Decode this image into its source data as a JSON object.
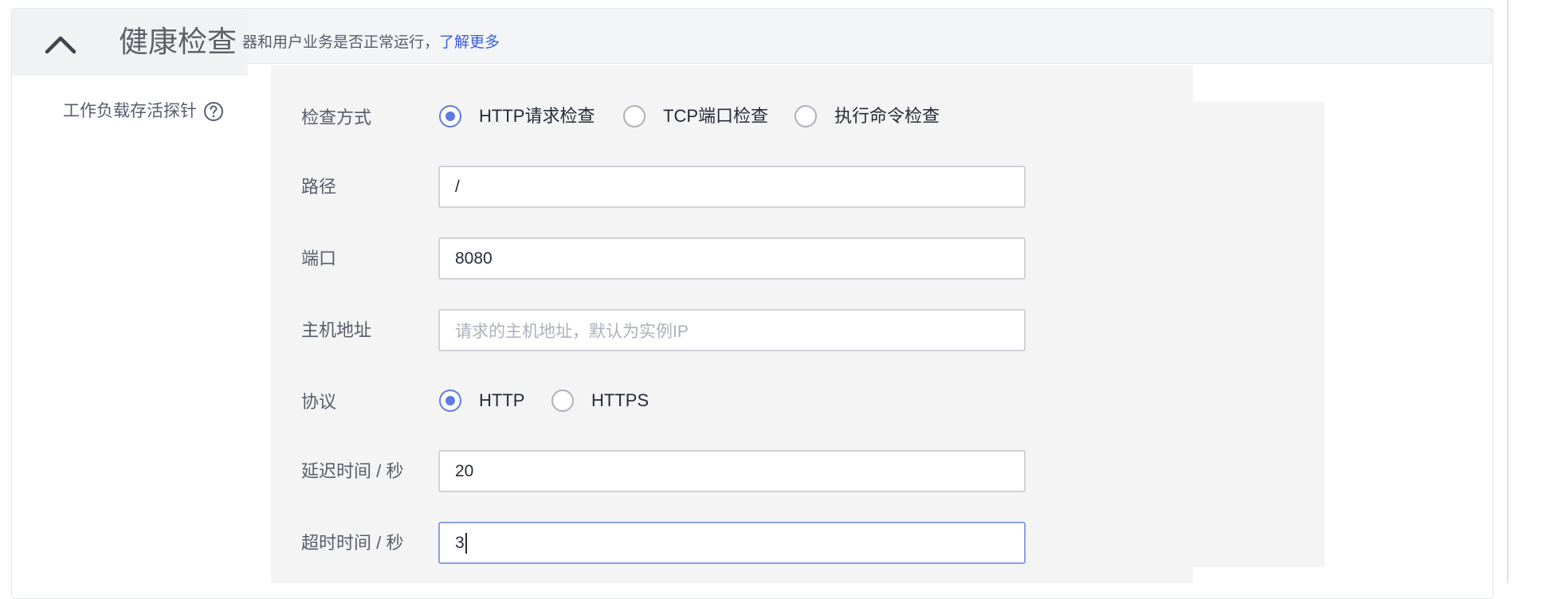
{
  "section": {
    "title": "健康检查",
    "description": "器和用户业务是否正常运行，",
    "learn_more": "了解更多"
  },
  "probe": {
    "label": "工作负载存活探针"
  },
  "form": {
    "check_method": {
      "label": "检查方式",
      "options": [
        "HTTP请求检查",
        "TCP端口检查",
        "执行命令检查"
      ],
      "selected": "HTTP请求检查"
    },
    "path": {
      "label": "路径",
      "value": "/"
    },
    "port": {
      "label": "端口",
      "value": "8080"
    },
    "host": {
      "label": "主机地址",
      "value": "",
      "placeholder": "请求的主机地址，默认为实例IP"
    },
    "protocol": {
      "label": "协议",
      "options": [
        "HTTP",
        "HTTPS"
      ],
      "selected": "HTTP"
    },
    "delay": {
      "label": "延迟时间 / 秒",
      "value": "20"
    },
    "timeout": {
      "label": "超时时间 / 秒",
      "value": "3"
    }
  },
  "colors": {
    "accent": "#5e7ce0",
    "link": "#3b5fd9",
    "form_background": "#f4f4f4"
  }
}
